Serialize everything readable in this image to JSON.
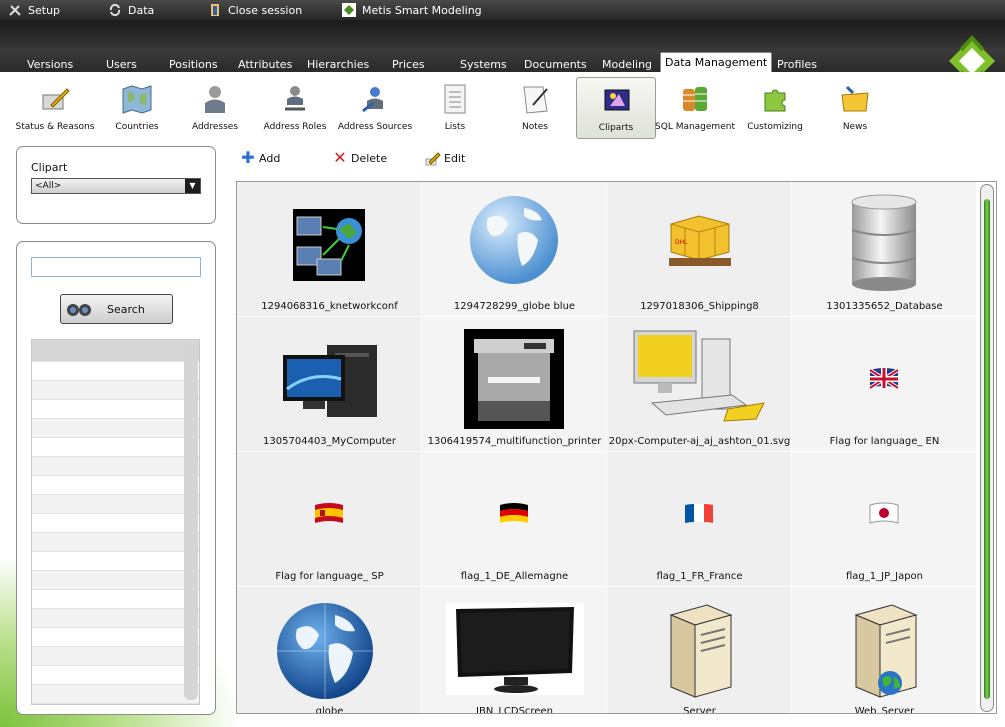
{
  "menubar": {
    "setup": "Setup",
    "data": "Data",
    "close": "Close session",
    "app": "Metis Smart Modeling"
  },
  "tabs": [
    "Versions",
    "Users",
    "Positions",
    "Attributes",
    "Hierarchies",
    "Prices",
    "Systems",
    "Documents",
    "Modeling",
    "Data Management",
    "Profiles"
  ],
  "active_tab": "Data Management",
  "toolbar": [
    "Status & Reasons",
    "Countries",
    "Addresses",
    "Address Roles",
    "Address Sources",
    "Lists",
    "Notes",
    "Cliparts",
    "SQL Management",
    "Customizing",
    "News"
  ],
  "active_toolbar": "Cliparts",
  "filter": {
    "label": "Clipart",
    "selected": "<All>"
  },
  "search": {
    "placeholder": "",
    "button": "Search"
  },
  "actions": {
    "add": "Add",
    "delete": "Delete",
    "edit": "Edit"
  },
  "gallery": [
    {
      "caption": "1294068316_knetworkconf",
      "icon": "network-icon"
    },
    {
      "caption": "1294728299_globe blue",
      "icon": "globe-icon"
    },
    {
      "caption": "1297018306_Shipping8",
      "icon": "shipping-boxes-icon"
    },
    {
      "caption": "1301335652_Database",
      "icon": "database-icon"
    },
    {
      "caption": "1305704403_MyComputer",
      "icon": "computer-icon"
    },
    {
      "caption": "1306419574_multifunction_printer",
      "icon": "printer-icon"
    },
    {
      "caption": "20px-Computer-aj_aj_ashton_01.svg",
      "icon": "computer-icon"
    },
    {
      "caption": "Flag for language_ EN",
      "icon": "flag-uk-icon"
    },
    {
      "caption": "Flag for language_ SP",
      "icon": "flag-es-icon"
    },
    {
      "caption": "flag_1_DE_Allemagne",
      "icon": "flag-de-icon"
    },
    {
      "caption": "flag_1_FR_France",
      "icon": "flag-fr-icon"
    },
    {
      "caption": "flag_1_JP_Japon",
      "icon": "flag-jp-icon"
    },
    {
      "caption": "globe",
      "icon": "globe-icon"
    },
    {
      "caption": "IBN_LCDScreen",
      "icon": "monitor-icon"
    },
    {
      "caption": "Server",
      "icon": "server-icon"
    },
    {
      "caption": "Web_Server",
      "icon": "web-server-icon"
    }
  ]
}
